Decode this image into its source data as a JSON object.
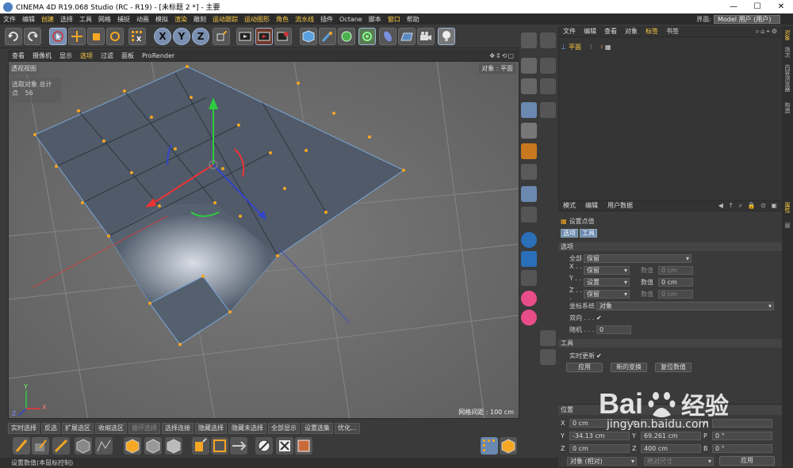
{
  "window": {
    "title": "CINEMA 4D R19.068 Studio (RC - R19) - [未标题 2 *] - 主要",
    "controls": [
      "—",
      "☐",
      "✕"
    ]
  },
  "menubar": {
    "items": [
      "文件",
      "编辑",
      "创建",
      "选择",
      "工具",
      "网格",
      "捕捉",
      "动画",
      "模拟",
      "渲染",
      "雕刻",
      "运动跟踪",
      "运动图形",
      "角色",
      "流水线",
      "插件",
      "Octane",
      "脚本",
      "窗口",
      "帮助"
    ],
    "highlighted": [
      2,
      9,
      11,
      12,
      13,
      14,
      18
    ],
    "layout_label": "界面:",
    "layout_value": "Model 用户 (用户)"
  },
  "viewport": {
    "menu": [
      "查看",
      "摄像机",
      "显示",
      "选项",
      "过滤",
      "面板",
      "ProRender"
    ],
    "menu_highlight": 3,
    "view_name": "透视视图",
    "hud_label": "选取对象 总计",
    "hud_points_label": "点",
    "hud_points_value": "56",
    "object_tag": "对象 : 平面",
    "grid_info": "网格间距 : 100 cm",
    "axis_labels": [
      "Y",
      "Z",
      "X"
    ]
  },
  "timeline": {
    "items": [
      "实时选择",
      "反选",
      "扩展选区",
      "收缩选区",
      "循环选择",
      "选择连接",
      "隐藏选择",
      "隐藏未选择",
      "全部显示",
      "设置选集",
      "优化..."
    ],
    "dim": [
      4
    ]
  },
  "statusbar": {
    "text": "设置数值(本鼠标控制)"
  },
  "object_manager": {
    "menu": [
      "文件",
      "编辑",
      "查看",
      "对象",
      "标签",
      "书签"
    ],
    "menu_highlight": 4,
    "object_name": "平面"
  },
  "attributes": {
    "menu": [
      "模式",
      "编辑",
      "用户数据"
    ],
    "tool_title": "设置点值",
    "tabs": [
      "选项",
      "工具"
    ],
    "section_options": "选项",
    "all_label": "全部",
    "all_value": "保留",
    "x_label": "X . . .",
    "x_mode": "保留",
    "x_value_label": "数值",
    "x_value": "0 cm",
    "y_label": "Y . . .",
    "y_mode": "设置",
    "y_value_label": "数值",
    "y_value": "0 cm",
    "z_label": "Z . . .",
    "z_mode": "保留",
    "z_value_label": "数值",
    "z_value": "0 cm",
    "coord_label": "坐标系统",
    "coord_value": "对象",
    "twoway_label": "双向 . . .",
    "twoway_check": "✔",
    "random_label": "随机 . . .",
    "random_value": "0",
    "section_tool": "工具",
    "realtime_label": "实时更新",
    "realtime_check": "✔",
    "buttons": [
      "应用",
      "新的变换",
      "复位数值"
    ]
  },
  "coordinates": {
    "header": "位置",
    "rows": [
      {
        "axis": "X",
        "value": "0 cm",
        "s_axis": "X",
        "s_value": "",
        "r_axis": "H",
        "r_value": ""
      },
      {
        "axis": "Y",
        "value": "-34.13 cm",
        "s_axis": "Y",
        "s_value": "69.261 cm",
        "r_axis": "P",
        "r_value": "0 °"
      },
      {
        "axis": "Z",
        "value": "0 cm",
        "s_axis": "Z",
        "s_value": "400 cm",
        "r_axis": "B",
        "r_value": "0 °"
      }
    ],
    "mode": "对象 (相对)",
    "size_mode": "绝对尺寸",
    "apply": "应用"
  },
  "right_tabs": [
    "对象",
    "场次",
    "内容浏览器",
    "构造",
    "属性",
    "层"
  ],
  "watermark": {
    "brand": "Bai",
    "brand2": "经验",
    "url": "jingyan.baidu.com"
  }
}
